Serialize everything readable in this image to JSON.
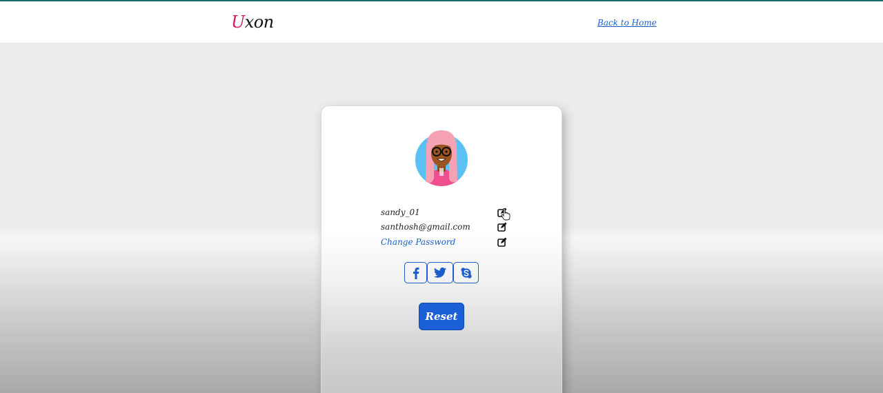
{
  "header": {
    "logo_first": "U",
    "logo_rest": "xon",
    "back_link": "Back to Home"
  },
  "profile": {
    "username": "sandy_01",
    "email": "santhosh@gmail.com",
    "change_password": "Change Password"
  },
  "social": [
    {
      "icon": "facebook-icon"
    },
    {
      "icon": "twitter-icon"
    },
    {
      "icon": "skype-icon"
    }
  ],
  "reset_label": "Reset",
  "colors": {
    "accent": "#1a5fd6",
    "logo_accent": "#d81b5f",
    "link": "#1a5fc9",
    "top_border": "#1a6b6b"
  }
}
